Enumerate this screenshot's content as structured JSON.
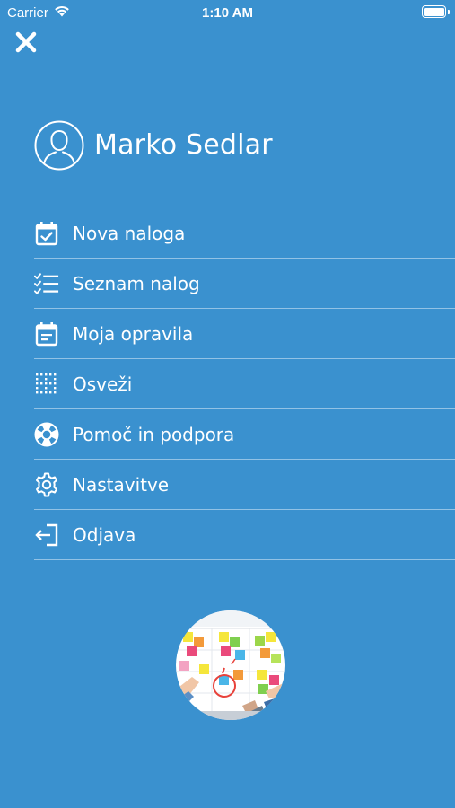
{
  "status_bar": {
    "carrier": "Carrier",
    "time": "1:10 AM",
    "wifi_icon": "wifi-icon",
    "battery_icon": "battery-icon"
  },
  "close_icon": "close-icon",
  "profile": {
    "name": "Marko Sedlar",
    "avatar_icon": "user-circle-icon"
  },
  "menu": {
    "items": [
      {
        "label": "Nova naloga",
        "icon": "calendar-check-icon"
      },
      {
        "label": "Seznam nalog",
        "icon": "checklist-icon"
      },
      {
        "label": "Moja opravila",
        "icon": "calendar-lines-icon"
      },
      {
        "label": "Osveži",
        "icon": "dotted-grid-icon"
      },
      {
        "label": "Pomoč in podpora",
        "icon": "lifebuoy-icon"
      },
      {
        "label": "Nastavitve",
        "icon": "gear-icon"
      },
      {
        "label": "Odjava",
        "icon": "logout-icon"
      }
    ]
  },
  "colors": {
    "background": "#3a91cf",
    "foreground": "#ffffff",
    "divider": "rgba(255,255,255,0.45)"
  }
}
